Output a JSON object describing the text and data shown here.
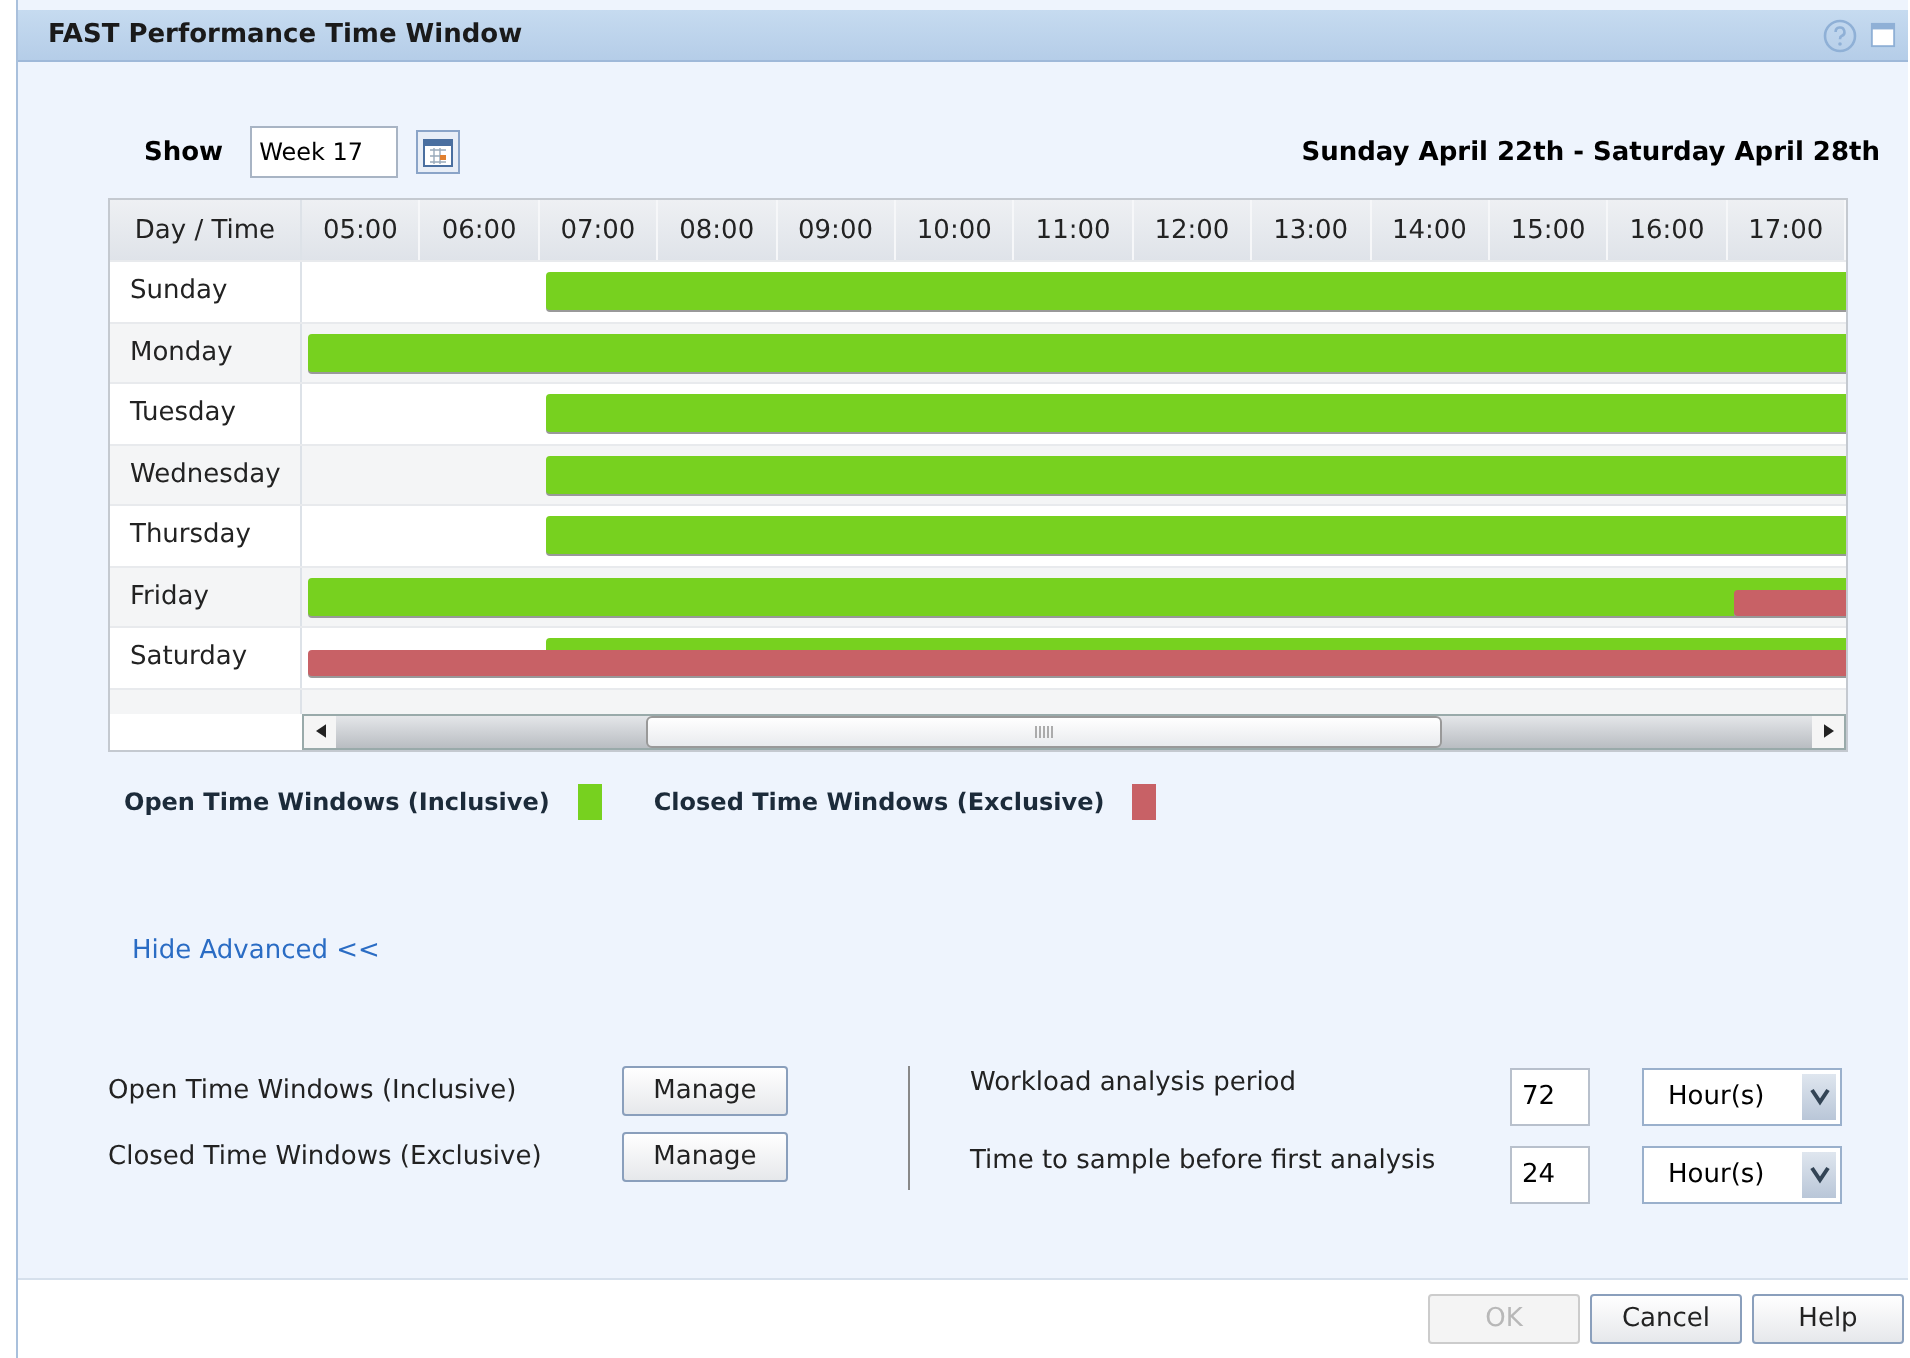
{
  "window": {
    "title": "FAST Performance Time Window"
  },
  "show": {
    "label": "Show",
    "value": "Week 17"
  },
  "date_range": "Sunday April 22th - Saturday April 28th",
  "grid": {
    "corner": "Day / Time",
    "columns": [
      "05:00",
      "06:00",
      "07:00",
      "08:00",
      "09:00",
      "10:00",
      "11:00",
      "12:00",
      "13:00",
      "14:00",
      "15:00",
      "16:00",
      "17:00"
    ],
    "rows": [
      {
        "day": "Sunday",
        "slots": [
          {
            "kind": "empty"
          },
          {
            "kind": "empty"
          },
          {
            "kind": "open"
          },
          {
            "kind": "open"
          },
          {
            "kind": "open"
          },
          {
            "kind": "open"
          },
          {
            "kind": "open"
          },
          {
            "kind": "open"
          },
          {
            "kind": "open"
          },
          {
            "kind": "open"
          },
          {
            "kind": "open"
          },
          {
            "kind": "open"
          },
          {
            "kind": "open"
          }
        ]
      },
      {
        "day": "Monday",
        "slots": [
          {
            "kind": "open"
          },
          {
            "kind": "open"
          },
          {
            "kind": "open"
          },
          {
            "kind": "open"
          },
          {
            "kind": "open"
          },
          {
            "kind": "open"
          },
          {
            "kind": "open"
          },
          {
            "kind": "open"
          },
          {
            "kind": "open"
          },
          {
            "kind": "open"
          },
          {
            "kind": "open"
          },
          {
            "kind": "open"
          },
          {
            "kind": "open"
          }
        ]
      },
      {
        "day": "Tuesday",
        "slots": [
          {
            "kind": "empty"
          },
          {
            "kind": "empty"
          },
          {
            "kind": "open"
          },
          {
            "kind": "open"
          },
          {
            "kind": "open"
          },
          {
            "kind": "open"
          },
          {
            "kind": "open"
          },
          {
            "kind": "open"
          },
          {
            "kind": "open"
          },
          {
            "kind": "open"
          },
          {
            "kind": "open"
          },
          {
            "kind": "open"
          },
          {
            "kind": "open"
          }
        ]
      },
      {
        "day": "Wednesday",
        "slots": [
          {
            "kind": "empty"
          },
          {
            "kind": "empty"
          },
          {
            "kind": "open"
          },
          {
            "kind": "open"
          },
          {
            "kind": "open"
          },
          {
            "kind": "open"
          },
          {
            "kind": "open"
          },
          {
            "kind": "open"
          },
          {
            "kind": "open"
          },
          {
            "kind": "open"
          },
          {
            "kind": "open"
          },
          {
            "kind": "open"
          },
          {
            "kind": "open"
          }
        ]
      },
      {
        "day": "Thursday",
        "slots": [
          {
            "kind": "empty"
          },
          {
            "kind": "empty"
          },
          {
            "kind": "open"
          },
          {
            "kind": "open"
          },
          {
            "kind": "open"
          },
          {
            "kind": "open"
          },
          {
            "kind": "open"
          },
          {
            "kind": "open"
          },
          {
            "kind": "open"
          },
          {
            "kind": "open"
          },
          {
            "kind": "open"
          },
          {
            "kind": "open"
          },
          {
            "kind": "open"
          }
        ]
      },
      {
        "day": "Friday",
        "slots": [
          {
            "kind": "open"
          },
          {
            "kind": "open"
          },
          {
            "kind": "open"
          },
          {
            "kind": "open"
          },
          {
            "kind": "open"
          },
          {
            "kind": "open"
          },
          {
            "kind": "open"
          },
          {
            "kind": "open"
          },
          {
            "kind": "open"
          },
          {
            "kind": "open"
          },
          {
            "kind": "open"
          },
          {
            "kind": "open"
          },
          {
            "kind": "both"
          }
        ]
      },
      {
        "day": "Saturday",
        "slots": [
          {
            "kind": "closed"
          },
          {
            "kind": "closed"
          },
          {
            "kind": "both"
          },
          {
            "kind": "both"
          },
          {
            "kind": "both"
          },
          {
            "kind": "both"
          },
          {
            "kind": "both"
          },
          {
            "kind": "both"
          },
          {
            "kind": "both"
          },
          {
            "kind": "both"
          },
          {
            "kind": "both"
          },
          {
            "kind": "both"
          },
          {
            "kind": "both"
          }
        ]
      }
    ]
  },
  "legend": [
    {
      "label": "Open Time Windows (Inclusive)",
      "color": "#77d11f"
    },
    {
      "label": "Closed Time Windows (Exclusive)",
      "color": "#c86166"
    }
  ],
  "advanced_link": "Hide Advanced <<",
  "manage_rows": [
    {
      "label": "Open Time Windows (Inclusive)",
      "button": "Manage"
    },
    {
      "label": "Closed Time Windows (Exclusive)",
      "button": "Manage"
    }
  ],
  "settings": [
    {
      "label": "Workload analysis period",
      "value": "72",
      "unit": "Hour(s)"
    },
    {
      "label": "Time to sample before first analysis",
      "value": "24",
      "unit": "Hour(s)"
    }
  ],
  "buttons": [
    {
      "label": "OK",
      "disabled": true
    },
    {
      "label": "Cancel",
      "disabled": false
    },
    {
      "label": "Help",
      "disabled": false
    }
  ]
}
